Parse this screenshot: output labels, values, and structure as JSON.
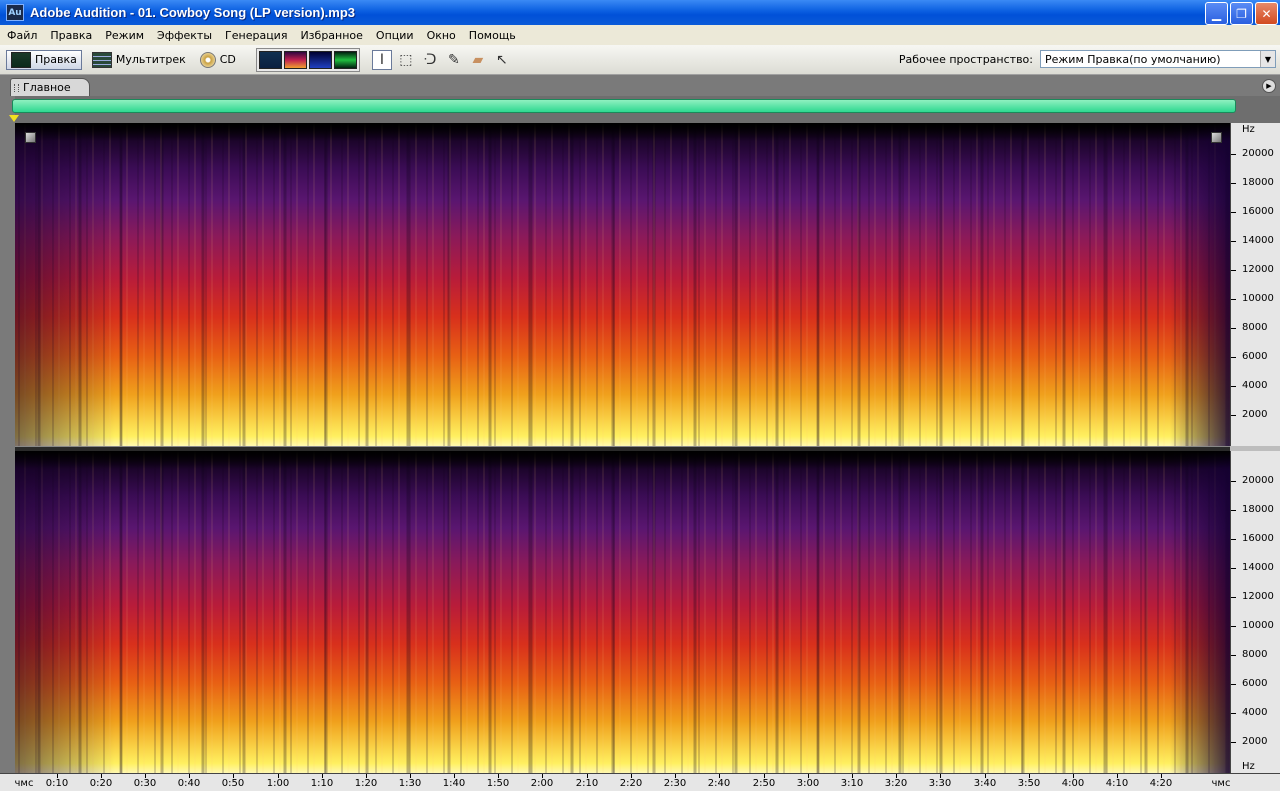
{
  "window": {
    "app_icon": "Au",
    "title": "Adobe Audition - 01. Cowboy Song (LP version).mp3",
    "buttons": [
      "minimize",
      "maximize",
      "close"
    ]
  },
  "menu": [
    "Файл",
    "Правка",
    "Режим",
    "Эффекты",
    "Генерация",
    "Избранное",
    "Опции",
    "Окно",
    "Помощь"
  ],
  "toolbar": {
    "modes": [
      {
        "label": "Правка",
        "icon": "waveform-edit-icon",
        "active": true
      },
      {
        "label": "Мультитрек",
        "icon": "multitrack-icon",
        "active": false
      },
      {
        "label": "CD",
        "icon": "cd-icon",
        "active": false
      }
    ],
    "views": [
      "waveform-view-icon",
      "spectral-frequency-view-icon",
      "spectral-pan-view-icon",
      "spectral-phase-view-icon"
    ],
    "tools": [
      "time-selection-tool-icon",
      "marquee-tool-icon",
      "lasso-tool-icon",
      "brush-tool-icon",
      "spot-healing-tool-icon",
      "hybrid-tool-icon"
    ],
    "workspace_label": "Рабочее пространство:",
    "workspace_value": "Режим Правка(по умолчанию)"
  },
  "panel": {
    "tab": "Главное"
  },
  "hz_ruler": {
    "unit": "Hz",
    "labels": [
      "20000",
      "18000",
      "16000",
      "14000",
      "12000",
      "10000",
      "8000",
      "6000",
      "4000",
      "2000"
    ]
  },
  "time_ruler": {
    "start": "чмс",
    "end": "чмс",
    "labels": [
      "0:10",
      "0:20",
      "0:30",
      "0:40",
      "0:50",
      "1:00",
      "1:10",
      "1:20",
      "1:30",
      "1:40",
      "1:50",
      "2:00",
      "2:10",
      "2:20",
      "2:30",
      "2:40",
      "2:50",
      "3:00",
      "3:10",
      "3:20",
      "3:30",
      "3:40",
      "3:50",
      "4:00",
      "4:10",
      "4:20"
    ]
  },
  "colors": {
    "titlebar": "#0a5ee0",
    "overview_bar": "#2ed890",
    "spectrogram_high": "#fff060",
    "spectrogram_mid": "#d8301c",
    "spectrogram_low": "#3b0c55"
  }
}
